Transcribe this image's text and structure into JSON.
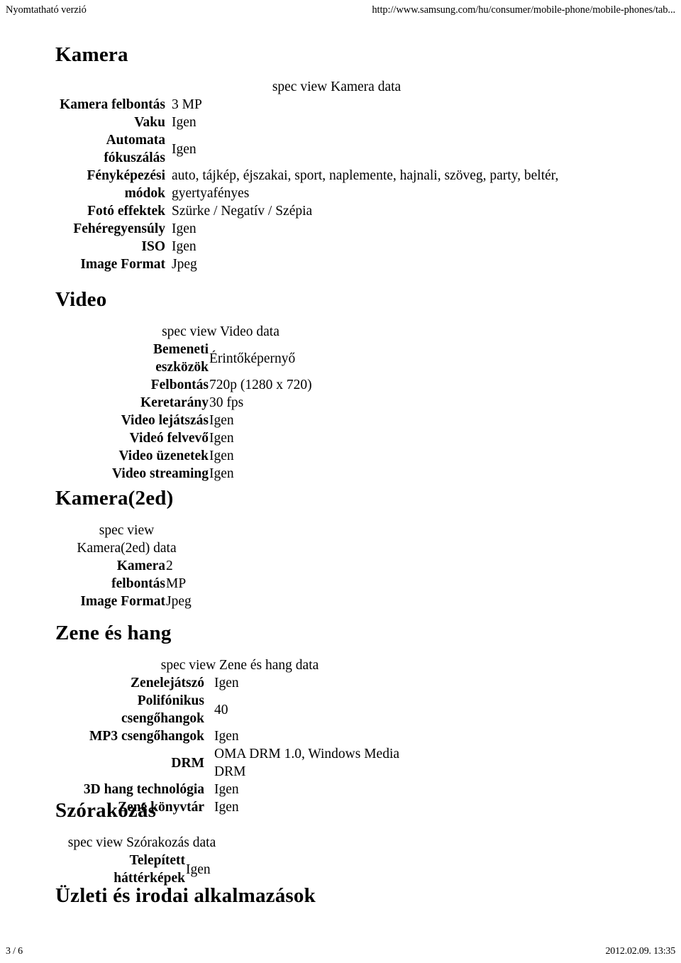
{
  "header": {
    "left": "Nyomtatható verzió",
    "right": "http://www.samsung.com/hu/consumer/mobile-phone/mobile-phones/tab..."
  },
  "footer": {
    "page": "3 / 6",
    "timestamp": "2012.02.09. 13:35"
  },
  "sections": [
    {
      "title": "Kamera",
      "caption": "spec view Kamera data",
      "rows": [
        {
          "label": "Kamera felbontás",
          "value": "3 MP"
        },
        {
          "label": "Vaku",
          "value": "Igen"
        },
        {
          "label": "Automata fókuszálás",
          "value": "Igen"
        },
        {
          "label": "Fényképezési módok",
          "value": "auto, tájkép, éjszakai, sport, naplemente, hajnali, szöveg, party, beltér, gyertyafényes"
        },
        {
          "label": "Fotó effektek",
          "value": "Szürke / Negatív / Szépia"
        },
        {
          "label": "Fehéregyensúly",
          "value": "Igen"
        },
        {
          "label": "ISO",
          "value": "Igen"
        },
        {
          "label": "Image Format",
          "value": "Jpeg"
        }
      ]
    },
    {
      "title": "Video",
      "caption": "spec view Video data",
      "rows": [
        {
          "label": "Bemeneti eszközök",
          "value": "Érintőképernyő"
        },
        {
          "label": "Felbontás",
          "value": "720p (1280 x 720)"
        },
        {
          "label": "Keretarány",
          "value": "30 fps"
        },
        {
          "label": "Video lejátszás",
          "value": "Igen"
        },
        {
          "label": "Videó felvevő",
          "value": "Igen"
        },
        {
          "label": "Video üzenetek",
          "value": "Igen"
        },
        {
          "label": "Video streaming",
          "value": "Igen"
        }
      ]
    },
    {
      "title": "Kamera(2ed)",
      "caption": "spec view Kamera(2ed) data",
      "rows": [
        {
          "label": "Kamera felbontás",
          "value": "2 MP"
        },
        {
          "label": "Image Format",
          "value": "Jpeg"
        }
      ]
    },
    {
      "title": "Zene és hang",
      "caption": "spec view Zene és hang data",
      "rows": [
        {
          "label": "Zenelejátszó",
          "value": "Igen"
        },
        {
          "label": "Polifónikus csengőhangok",
          "value": "40"
        },
        {
          "label": "MP3 csengőhangok",
          "value": "Igen"
        },
        {
          "label": "DRM",
          "value": "OMA DRM 1.0, Windows Media DRM"
        },
        {
          "label": "3D hang technológia",
          "value": "Igen"
        },
        {
          "label": "Zene könyvtár",
          "value": "Igen"
        }
      ]
    },
    {
      "title": "Szórakozás",
      "caption": "spec view Szórakozás data",
      "rows": [
        {
          "label": "Telepített háttérképek",
          "value": "Igen"
        }
      ]
    },
    {
      "title": "Üzleti és irodai alkalmazások",
      "caption": "",
      "rows": []
    }
  ]
}
